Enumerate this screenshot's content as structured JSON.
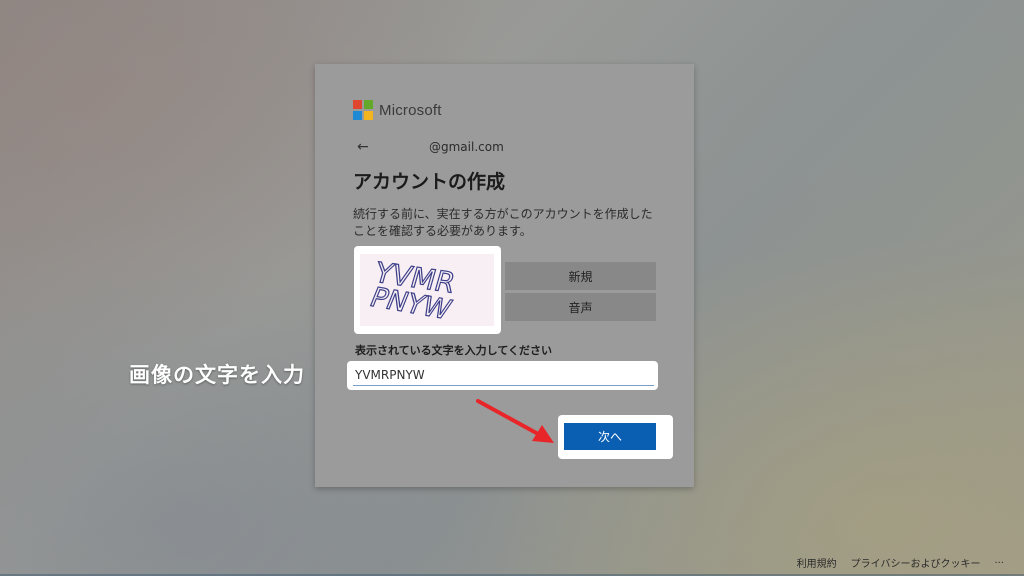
{
  "brand": {
    "name": "Microsoft"
  },
  "identity": {
    "back_icon": "←",
    "email": "@gmail.com"
  },
  "page_title": "アカウントの作成",
  "description": "続行する前に、実在する方がこのアカウントを作成したことを確認する必要があります。",
  "captcha": {
    "image_text_line1": "YVMR",
    "image_text_line2": "PNYW",
    "new_button": "新規",
    "audio_button": "音声",
    "input_label": "表示されている文字を入力してください",
    "input_value": "YVMRPNYW"
  },
  "next_button": "次へ",
  "annotation": "画像の文字を入力",
  "footer": {
    "terms": "利用規約",
    "privacy": "プライバシーおよびクッキー",
    "more": "..."
  },
  "colors": {
    "primary_button": "#0a5fb3",
    "arrow": "#e8262a",
    "logo_red": "#e0462f",
    "logo_green": "#63a82a",
    "logo_blue": "#1f89d6",
    "logo_yellow": "#f3b51f"
  }
}
